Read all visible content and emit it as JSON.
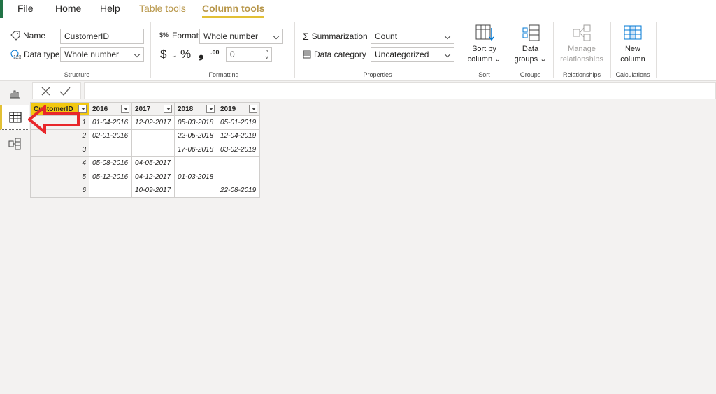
{
  "menu": {
    "file": "File",
    "home": "Home",
    "help": "Help",
    "table_tools": "Table tools",
    "column_tools": "Column tools"
  },
  "structure": {
    "name_label": "Name",
    "name_value": "CustomerID",
    "datatype_label": "Data type",
    "datatype_value": "Whole number",
    "group_label": "Structure"
  },
  "formatting": {
    "format_label": "Format",
    "format_value": "Whole number",
    "currency_symbol": "$",
    "percent_symbol": "%",
    "comma_symbol": "❟",
    "decimal_icon": ".00",
    "decimals_value": "0",
    "group_label": "Formatting"
  },
  "properties": {
    "summarization_label": "Summarization",
    "summarization_value": "Count",
    "category_label": "Data category",
    "category_value": "Uncategorized",
    "group_label": "Properties"
  },
  "sort": {
    "line1": "Sort by",
    "line2": "column",
    "group_label": "Sort"
  },
  "groups": {
    "line1": "Data",
    "line2": "groups",
    "group_label": "Groups"
  },
  "relationships": {
    "line1": "Manage",
    "line2": "relationships",
    "group_label": "Relationships"
  },
  "calculations": {
    "line1": "New",
    "line2": "column",
    "group_label": "Calculations"
  },
  "table": {
    "headers": [
      "CustomerID",
      "2016",
      "2017",
      "2018",
      "2019"
    ],
    "rows": [
      [
        "1",
        "01-04-2016",
        "12-02-2017",
        "05-03-2018",
        "05-01-2019"
      ],
      [
        "2",
        "02-01-2016",
        "",
        "22-05-2018",
        "12-04-2019"
      ],
      [
        "3",
        "",
        "",
        "17-06-2018",
        "03-02-2019"
      ],
      [
        "4",
        "05-08-2016",
        "04-05-2017",
        "",
        ""
      ],
      [
        "5",
        "05-12-2016",
        "04-12-2017",
        "01-03-2018",
        ""
      ],
      [
        "6",
        "",
        "10-09-2017",
        "",
        "22-08-2019"
      ]
    ]
  },
  "colors": {
    "accent": "#f2c811",
    "context_tab": "#b8974a",
    "arrow": "#e8262a"
  }
}
